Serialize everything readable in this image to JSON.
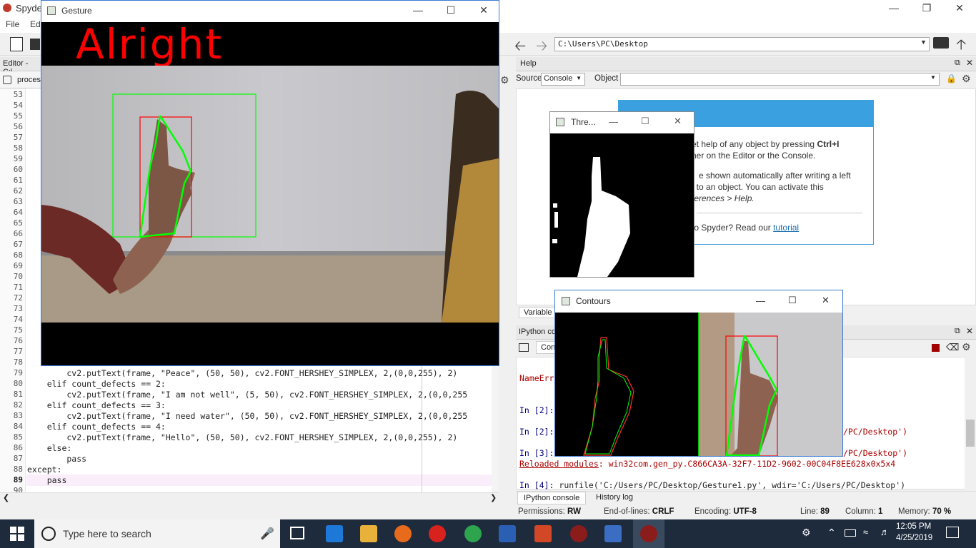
{
  "spyder": {
    "title": "Spyde",
    "menu": [
      "File",
      "Edi"
    ],
    "path": "C:\\Users\\PC\\Desktop",
    "editor_header": "Editor - C:\\",
    "editor_tab": "proces"
  },
  "editor": {
    "line_numbers": [
      "53",
      "54",
      "55",
      "56",
      "57",
      "58",
      "59",
      "60",
      "61",
      "62",
      "63",
      "64",
      "65",
      "66",
      "67",
      "68",
      "69",
      "70",
      "71",
      "72",
      "73",
      "74",
      "75",
      "76",
      "77",
      "78",
      "79",
      "80",
      "81",
      "82",
      "83",
      "84",
      "85",
      "86",
      "87",
      "88",
      "89",
      "90"
    ],
    "code": {
      "l79": "        cv2.putText(frame, \"Peace\", (50, 50), cv2.FONT_HERSHEY_SIMPLEX, 2,(0,0,255), 2)",
      "l80": "    elif count_defects == 2:",
      "l81": "        cv2.putText(frame, \"I am not well\", (5, 50), cv2.FONT_HERSHEY_SIMPLEX, 2,(0,0,255",
      "l82": "    elif count_defects == 3:",
      "l83": "        cv2.putText(frame, \"I need water\", (50, 50), cv2.FONT_HERSHEY_SIMPLEX, 2,(0,0,255",
      "l84": "    elif count_defects == 4:",
      "l85": "        cv2.putText(frame, \"Hello\", (50, 50), cv2.FONT_HERSHEY_SIMPLEX, 2,(0,0,255), 2)",
      "l86": "    else:",
      "l87": "        pass",
      "l88": "except:",
      "l89": "    pass"
    }
  },
  "help": {
    "header": "Help",
    "source_label": "Source",
    "source_value": "Console",
    "object_label": "Object",
    "text1a": "et help of any object by pressing ",
    "text1b": "Ctrl+I",
    "text2": "ner on the Editor or the Console.",
    "text3": "e shown automatically after writing a left",
    "text4": "t to an object. You can activate this",
    "text5": "ferences > Help.",
    "text6": " to Spyder? Read our ",
    "tutorial_link": "tutorial",
    "tab_variable": "Variable e"
  },
  "ipython": {
    "header": "IPython co",
    "tab": "Con",
    "lines": {
      "name_err": "NameErr",
      "p2a": "In [2]:",
      "p2b": "In [2]:",
      "p2b_tail": "/PC/Desktop')",
      "p3": "In [3]:",
      "p3_tail": "/PC/Desktop')",
      "reloaded_label": "Reloaded modules",
      "reloaded_rest": ": win32com.gen_py.C866CA3A-32F7-11D2-9602-00C04F8EE628x0x5x4",
      "p4_prompt": "In [4]:",
      "p4_cmd": " runfile('C:/Users/PC/Desktop/Gesture1.py', wdir='C:/Users/PC/Desktop')"
    },
    "bottom_tabs": [
      "IPython console",
      "History log"
    ]
  },
  "statusbar": {
    "permissions_label": "Permissions:",
    "permissions": "RW",
    "eol_label": "End-of-lines:",
    "eol": "CRLF",
    "encoding_label": "Encoding:",
    "encoding": "UTF-8",
    "line_label": "Line:",
    "line": "89",
    "column_label": "Column:",
    "column": "1",
    "memory_label": "Memory:",
    "memory": "70 %"
  },
  "gesture": {
    "title": "Gesture",
    "overlay_text": "Alright",
    "overlay_color": "#ff0000"
  },
  "threshold": {
    "title": "Thre..."
  },
  "contours": {
    "title": "Contours"
  },
  "taskbar": {
    "search_placeholder": "Type here to search",
    "time": "12:05 PM",
    "date": "4/25/2019"
  }
}
